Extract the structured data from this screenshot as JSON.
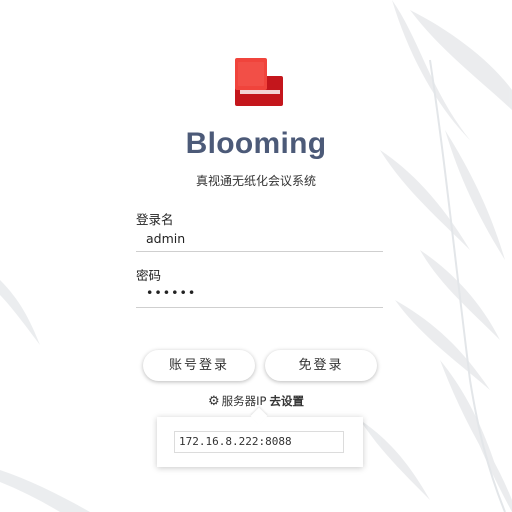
{
  "app": {
    "name": "Blooming",
    "subtitle": "真视通无纸化会议系统"
  },
  "login_form": {
    "username_label": "登录名",
    "username_value": "admin",
    "password_label": "密码",
    "password_value": "••••••"
  },
  "buttons": {
    "account_login": "账号登录",
    "guest_login": "免登录"
  },
  "server": {
    "label": "服务器IP",
    "settings_link": "去设置",
    "ip_value": "172.16.8.222:8088"
  },
  "colors": {
    "accent_red": "#e8382f",
    "title_blue_gray": "#4c5a78"
  },
  "icons": [
    "book-logo-icon",
    "gear-icon"
  ]
}
